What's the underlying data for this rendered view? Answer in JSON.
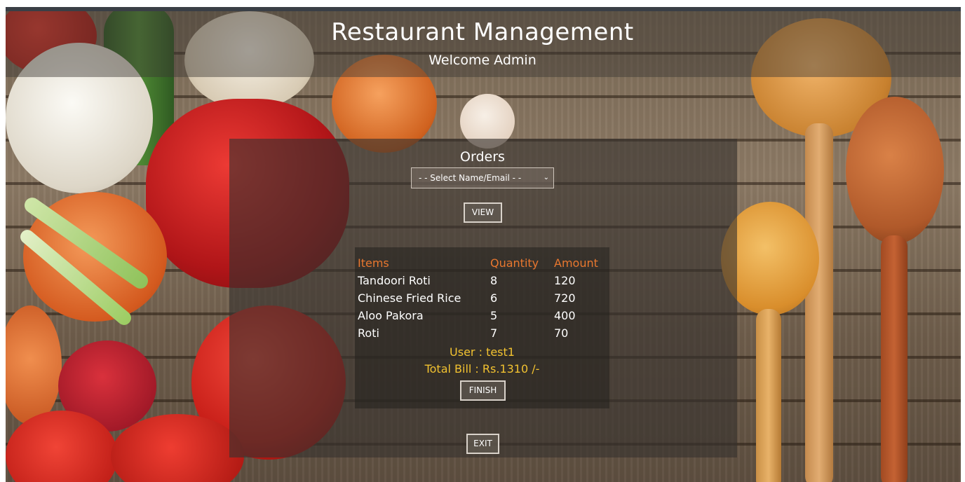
{
  "app": {
    "title": "Restaurant Management",
    "welcome": "Welcome Admin"
  },
  "orders": {
    "heading": "Orders",
    "select": {
      "selected": "- - Select Name/Email - -",
      "caret": "⌄"
    },
    "view_label": "VIEW",
    "table": {
      "headers": [
        "Items",
        "Quantity",
        "Amount"
      ],
      "rows": [
        [
          "Tandoori Roti",
          "8",
          "120"
        ],
        [
          "Chinese Fried Rice",
          "6",
          "720"
        ],
        [
          "Aloo Pakora",
          "5",
          "400"
        ],
        [
          "Roti",
          "7",
          "70"
        ]
      ]
    },
    "user_text": "User : test1",
    "total_text": "Total Bill : Rs.1310 /-",
    "finish_label": "FINISH"
  },
  "exit_label": "EXIT",
  "colors": {
    "header_text": "#e8772f",
    "summary_text": "#f2c230",
    "text": "#ffffff"
  }
}
